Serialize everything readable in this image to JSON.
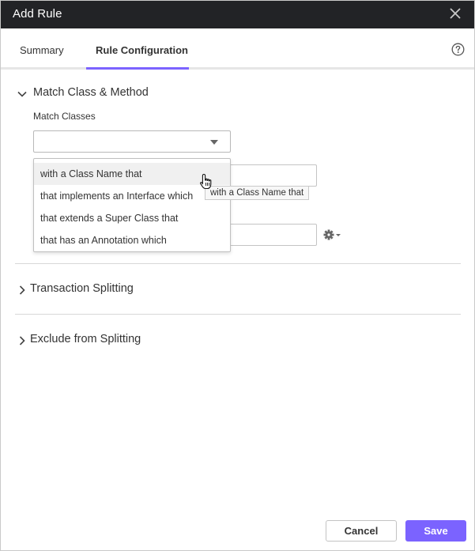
{
  "dialog": {
    "title": "Add Rule"
  },
  "tabs": [
    {
      "label": "Summary",
      "active": false
    },
    {
      "label": "Rule Configuration",
      "active": true
    }
  ],
  "sections": {
    "match": {
      "title": "Match Class & Method",
      "expanded": true,
      "match_classes_label": "Match Classes",
      "match_classes_value": "",
      "options": [
        "with a Class Name that",
        "that implements an Interface which",
        "that extends a Super Class that",
        "that has an Annotation which"
      ],
      "hovered_option_tooltip": "with a Class Name that"
    },
    "splitting": {
      "title": "Transaction Splitting",
      "expanded": false
    },
    "exclude": {
      "title": "Exclude from Splitting",
      "expanded": false
    }
  },
  "footer": {
    "cancel_label": "Cancel",
    "save_label": "Save"
  },
  "colors": {
    "accent": "#7b63ff",
    "titlebar": "#222326"
  }
}
